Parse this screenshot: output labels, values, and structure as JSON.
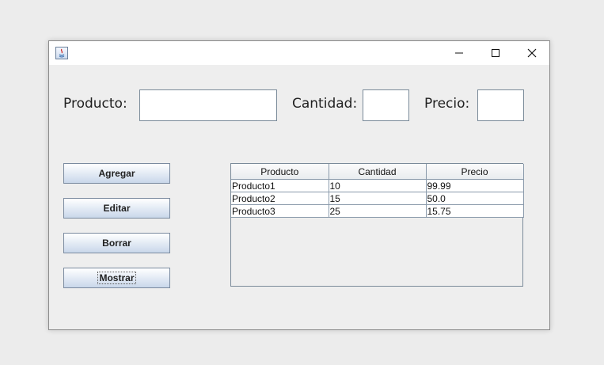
{
  "form": {
    "producto_label": "Producto:",
    "cantidad_label": "Cantidad:",
    "precio_label": "Precio:",
    "producto_value": "",
    "cantidad_value": "",
    "precio_value": ""
  },
  "buttons": {
    "agregar": "Agregar",
    "editar": "Editar",
    "borrar": "Borrar",
    "mostrar": "Mostrar"
  },
  "table": {
    "columns": [
      "Producto",
      "Cantidad",
      "Precio"
    ],
    "rows": [
      [
        "Producto1",
        "10",
        "99.99"
      ],
      [
        "Producto2",
        "15",
        "50.0"
      ],
      [
        "Producto3",
        "25",
        "15.75"
      ]
    ]
  },
  "icons": {
    "app": "java-app-icon",
    "minimize": "minimize-icon",
    "maximize": "maximize-icon",
    "close": "close-icon"
  },
  "colors": {
    "window_bg": "#eeeeee",
    "titlebar_bg": "#ffffff",
    "button_gradient_top": "#ffffff",
    "button_gradient_bottom": "#c9d7ea"
  }
}
